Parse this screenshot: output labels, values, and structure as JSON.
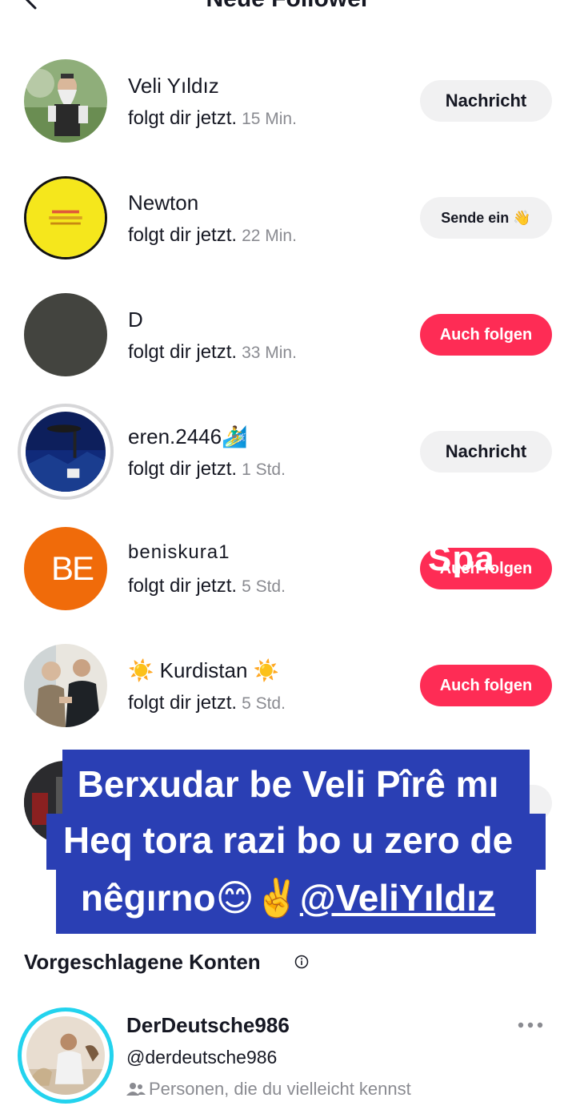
{
  "header": {
    "title": "Neue Follower"
  },
  "followers": [
    {
      "name": "Veli Yıldız",
      "action": "folgt dir jetzt.",
      "time": "15 Min.",
      "button": "Nachricht"
    },
    {
      "name": "Newton",
      "action": "folgt dir jetzt.",
      "time": "22 Min.",
      "button": "Sende ein 👋"
    },
    {
      "name": "D",
      "action": "folgt dir jetzt.",
      "time": "33 Min.",
      "button": "Auch folgen"
    },
    {
      "name": "eren.2446🏄‍♂️",
      "action": "folgt dir jetzt.",
      "time": "1 Std.",
      "button": "Nachricht"
    },
    {
      "name": "beniskura1",
      "action": "folgt dir jetzt.",
      "time": "5 Std.",
      "button": "Auch folgen",
      "avatar_text": "BE"
    },
    {
      "name": "☀️ Kurdistan ☀️",
      "action": "folgt dir jetzt.",
      "time": "5 Std.",
      "button": "Auch folgen"
    }
  ],
  "overlay_text": {
    "spa": "Spa"
  },
  "caption": {
    "line1": "Berxudar be Veli Pîrê mı",
    "line2": "Heq tora razi bo u zero de",
    "line3_text": "nêgırno😊✌️",
    "line3_mention": "@VeliYıldız"
  },
  "suggested": {
    "section_title": "Vorgeschlagene Konten",
    "account": {
      "name": "DerDeutsche986",
      "handle": "@derdeutsche986",
      "reason": "Personen, die du vielleicht kennst"
    }
  },
  "colors": {
    "accent_red": "#fe2c55",
    "caption_bg": "#2a3fb4",
    "ring_cyan": "#23d3ee"
  }
}
